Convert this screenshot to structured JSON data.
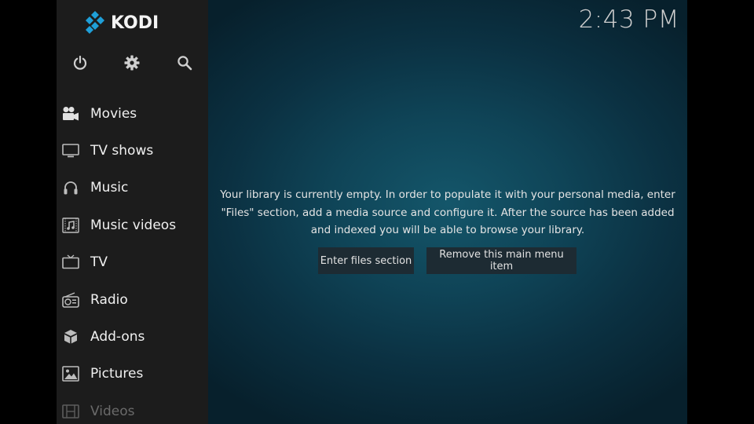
{
  "app": {
    "logo_text": "KODI"
  },
  "header": {
    "clock": "2:43 PM"
  },
  "top_icons": [
    {
      "icon": "power-icon"
    },
    {
      "icon": "gear-icon"
    },
    {
      "icon": "search-icon"
    }
  ],
  "menu": {
    "items": [
      {
        "label": "Movies",
        "icon": "movie-camera-icon"
      },
      {
        "label": "TV shows",
        "icon": "monitor-icon"
      },
      {
        "label": "Music",
        "icon": "headphones-icon"
      },
      {
        "label": "Music videos",
        "icon": "music-video-icon"
      },
      {
        "label": "TV",
        "icon": "tv-icon"
      },
      {
        "label": "Radio",
        "icon": "radio-icon"
      },
      {
        "label": "Add-ons",
        "icon": "addons-box-icon"
      },
      {
        "label": "Pictures",
        "icon": "picture-icon"
      },
      {
        "label": "Videos",
        "icon": "film-strip-icon"
      }
    ]
  },
  "main": {
    "message_lines": [
      "Your library is currently empty. In order to populate it with your personal media, enter",
      "\"Files\" section, add a media source and configure it. After the source has been added",
      "and indexed you will be able to browse your library."
    ],
    "buttons": {
      "enter_files": "Enter files section",
      "remove_item": "Remove this main menu item"
    }
  },
  "colors": {
    "sidebar_bg": "#1c1c1c",
    "content_bg_center": "#14566a",
    "content_bg_edge": "#07202c",
    "button_bg": "#1d2b33",
    "logo_blue": "#1f9fd8"
  }
}
